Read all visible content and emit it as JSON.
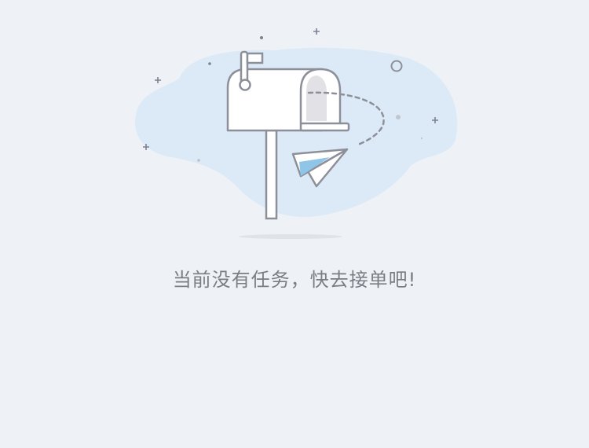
{
  "empty_state": {
    "message": "当前没有任务，快去接单吧!",
    "illustration_icon": "mailbox-with-paper-plane-icon"
  },
  "colors": {
    "background": "#eef2f6",
    "cloud": "#dce9f7",
    "outline": "#8e9099",
    "message_text": "#7a7d84",
    "plane_accent": "#8fc6e8"
  }
}
